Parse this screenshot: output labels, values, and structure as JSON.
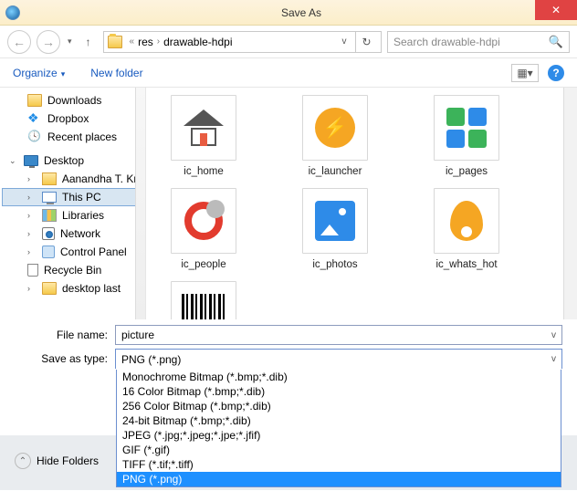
{
  "titlebar": {
    "title": "Save As"
  },
  "nav": {
    "back": "←",
    "forward": "→",
    "up": "↑",
    "refresh": "↻"
  },
  "address": {
    "crumb1": "res",
    "crumb2": "drawable-hdpi"
  },
  "search": {
    "placeholder": "Search drawable-hdpi"
  },
  "toolbar": {
    "organize": "Organize",
    "newfolder": "New folder"
  },
  "navpane": {
    "downloads": "Downloads",
    "dropbox": "Dropbox",
    "recent": "Recent places",
    "desktop": "Desktop",
    "user": "Aanandha T. Kris",
    "thispc": "This PC",
    "libraries": "Libraries",
    "network": "Network",
    "controlpanel": "Control Panel",
    "recyclebin": "Recycle Bin",
    "desktoplast": "desktop last"
  },
  "files": {
    "ic_home": "ic_home",
    "ic_launcher": "ic_launcher",
    "ic_pages": "ic_pages",
    "ic_people": "ic_people",
    "ic_photos": "ic_photos",
    "ic_whats_hot": "ic_whats_hot"
  },
  "fields": {
    "filename_label": "File name:",
    "filename_value": "picture",
    "saveastype_label": "Save as type:",
    "saveastype_value": "PNG (*.png)"
  },
  "type_options": {
    "o0": "Monochrome Bitmap (*.bmp;*.dib)",
    "o1": "16 Color Bitmap (*.bmp;*.dib)",
    "o2": "256 Color Bitmap (*.bmp;*.dib)",
    "o3": "24-bit Bitmap (*.bmp;*.dib)",
    "o4": "JPEG (*.jpg;*.jpeg;*.jpe;*.jfif)",
    "o5": "GIF (*.gif)",
    "o6": "TIFF (*.tif;*.tiff)",
    "o7": "PNG (*.png)"
  },
  "hidefolders": {
    "label": "Hide Folders"
  }
}
